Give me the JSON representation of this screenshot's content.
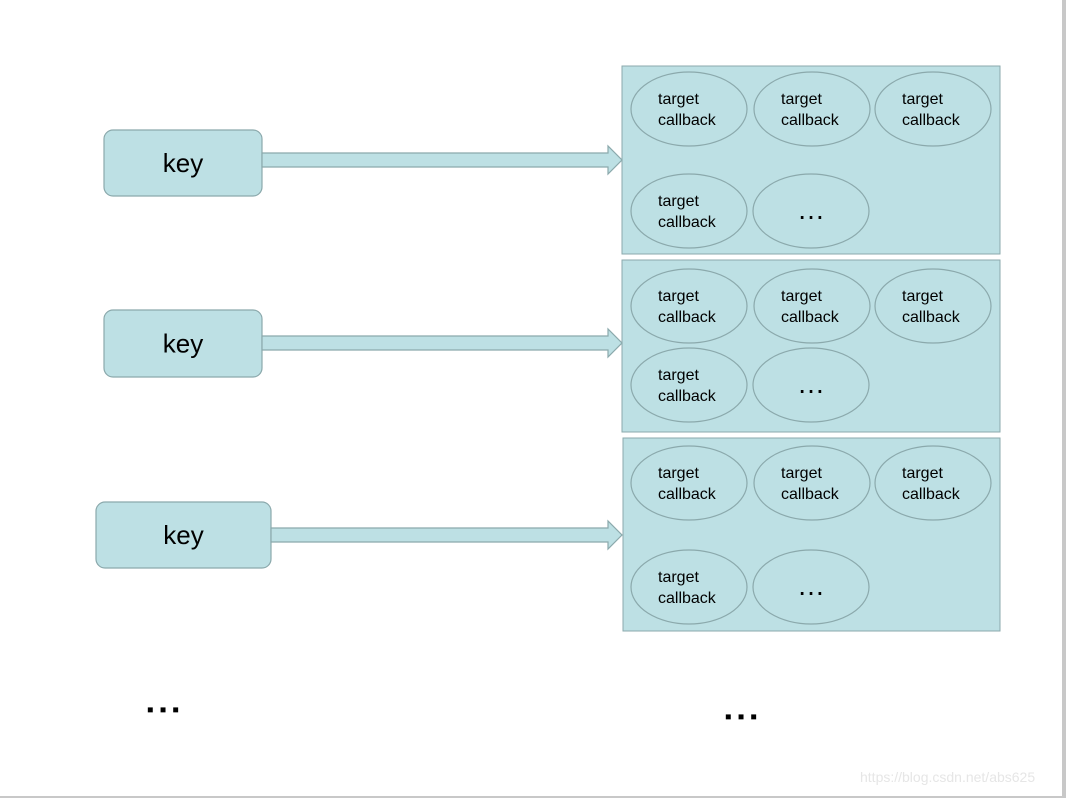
{
  "colors": {
    "fill": "#bde0e4",
    "stroke": "#8ba9ac",
    "text": "#000000"
  },
  "rows": [
    {
      "key": "key",
      "callbacks": [
        "target\ncallback",
        "target\ncallback",
        "target\ncallback",
        "target\ncallback",
        "…"
      ]
    },
    {
      "key": "key",
      "callbacks": [
        "target\ncallback",
        "target\ncallback",
        "target\ncallback",
        "target\ncallback",
        "…"
      ]
    },
    {
      "key": "key",
      "callbacks": [
        "target\ncallback",
        "target\ncallback",
        "target\ncallback",
        "target\ncallback",
        "…"
      ]
    }
  ],
  "more_keys": "▪ ▪ ▪",
  "more_lists": "▪ ▪ ▪",
  "watermark": "https://blog.csdn.net/abs625"
}
